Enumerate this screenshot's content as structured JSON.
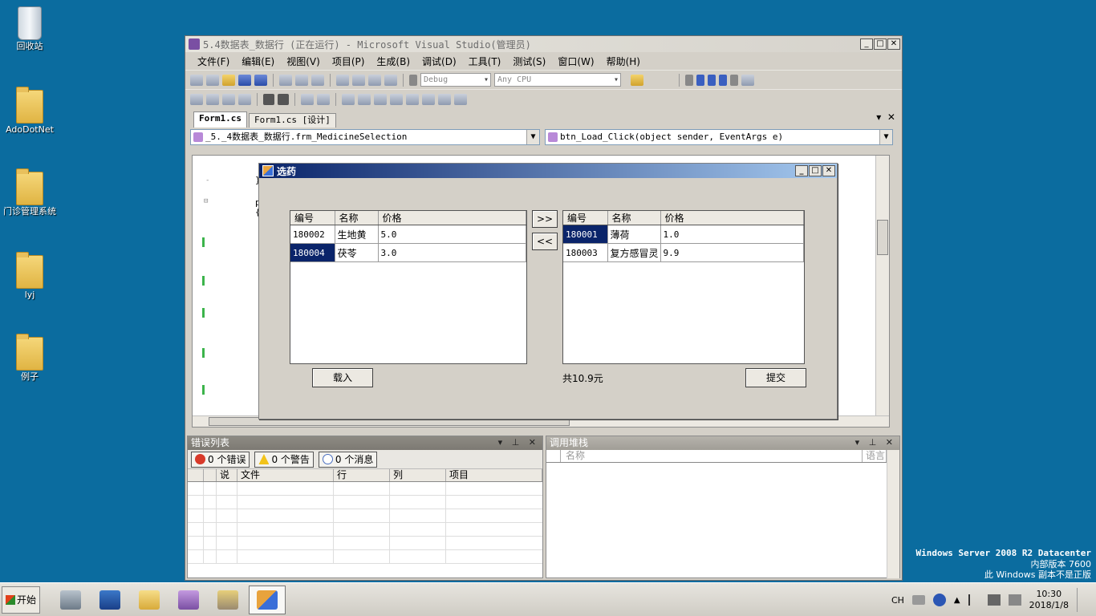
{
  "desktop": {
    "icons": [
      {
        "label": "回收站"
      },
      {
        "label": "AdoDotNet"
      },
      {
        "label": "门诊管理系统"
      },
      {
        "label": "lyj"
      },
      {
        "label": "例子"
      }
    ]
  },
  "vs": {
    "title": "5.4数据表_数据行 (正在运行) - Microsoft Visual Studio(管理员)",
    "menu": [
      "文件(F)",
      "编辑(E)",
      "视图(V)",
      "项目(P)",
      "生成(B)",
      "调试(D)",
      "工具(T)",
      "测试(S)",
      "窗口(W)",
      "帮助(H)"
    ],
    "toolbar": {
      "config": "Debug",
      "platform": "Any CPU"
    },
    "tabs": [
      "Form1.cs",
      "Form1.cs [设计]"
    ],
    "nav_left": "_5._4数据表_数据行.frm_MedicineSelection",
    "nav_right": "btn_Load_Click(object sender, EventArgs e)",
    "code": {
      "brace_close": "}",
      "pr": "pr",
      "brace_open": "{"
    }
  },
  "dialog": {
    "title": "选药",
    "left_grid": {
      "columns": [
        "编号",
        "名称",
        "价格"
      ],
      "rows": [
        [
          "180002",
          "生地黄",
          "5.0"
        ],
        [
          "180004",
          "茯苓",
          "3.0"
        ]
      ]
    },
    "right_grid": {
      "columns": [
        "编号",
        "名称",
        "价格"
      ],
      "rows": [
        [
          "180001",
          "薄荷",
          "1.0"
        ],
        [
          "180003",
          "复方感冒灵",
          "9.9"
        ]
      ]
    },
    "btn_add": ">>",
    "btn_remove": "<<",
    "btn_load": "载入",
    "total": "共10.9元",
    "btn_submit": "提交"
  },
  "error_list": {
    "title": "错误列表",
    "errors": "0 个错误",
    "warnings": "0 个警告",
    "messages": "0 个消息",
    "columns": [
      "说",
      "文件",
      "行",
      "列",
      "项目"
    ]
  },
  "call_stack": {
    "title": "调用堆栈",
    "columns": [
      "名称",
      "语言"
    ]
  },
  "taskbar": {
    "start": "开始",
    "lang": "CH",
    "time": "10:30",
    "date": "2018/1/8"
  },
  "watermark": {
    "line1": "Windows Server 2008 R2 Datacenter",
    "line2": "内部版本 7600",
    "line3": "此 Windows 副本不是正版"
  }
}
